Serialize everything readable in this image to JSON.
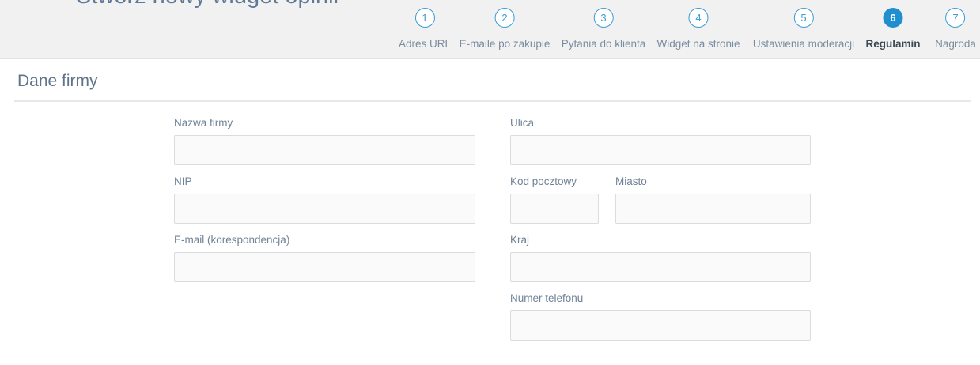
{
  "page": {
    "title": "Stwórz nowy widget opinii"
  },
  "steps": [
    {
      "number": "1",
      "label": "Adres URL",
      "active": false
    },
    {
      "number": "2",
      "label": "E-maile po zakupie",
      "active": false
    },
    {
      "number": "3",
      "label": "Pytania do klienta",
      "active": false
    },
    {
      "number": "4",
      "label": "Widget na stronie",
      "active": false
    },
    {
      "number": "5",
      "label": "Ustawienia moderacji",
      "active": false
    },
    {
      "number": "6",
      "label": "Regulamin",
      "active": true
    },
    {
      "number": "7",
      "label": "Nagroda",
      "active": false
    }
  ],
  "section": {
    "title": "Dane firmy"
  },
  "form": {
    "company_name": {
      "label": "Nazwa firmy",
      "value": ""
    },
    "nip": {
      "label": "NIP",
      "value": ""
    },
    "email": {
      "label": "E-mail (korespondencja)",
      "value": ""
    },
    "street": {
      "label": "Ulica",
      "value": ""
    },
    "postal_code": {
      "label": "Kod pocztowy",
      "value": ""
    },
    "city": {
      "label": "Miasto",
      "value": ""
    },
    "country": {
      "label": "Kraj",
      "value": ""
    },
    "phone": {
      "label": "Numer telefonu",
      "value": ""
    }
  },
  "colors": {
    "accent": "#1f8fd0",
    "header_bg": "#f1f1f1"
  }
}
